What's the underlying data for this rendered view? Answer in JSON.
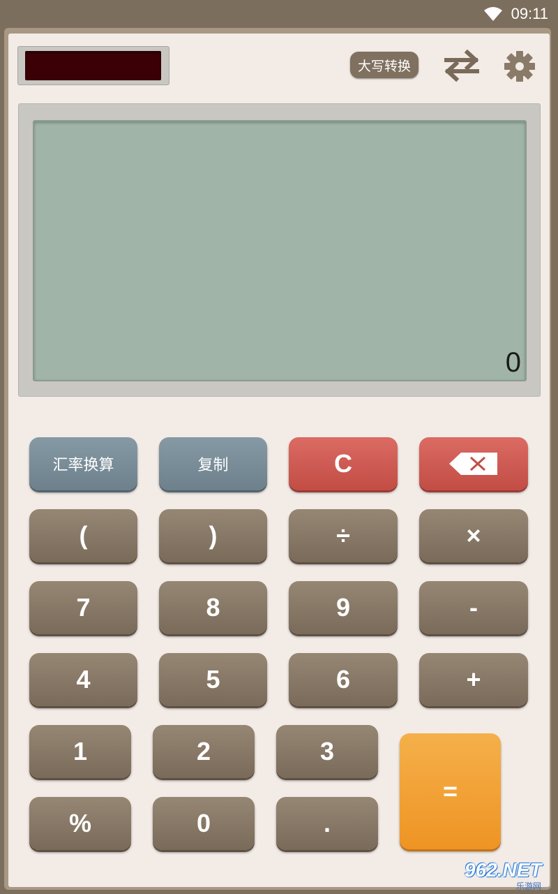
{
  "status_bar": {
    "time": "09:11",
    "wifi_icon": "wifi-icon"
  },
  "top_bar": {
    "uppercase_convert_label": "大写转换",
    "swap_icon": "swap-arrows-icon",
    "settings_icon": "gear-icon"
  },
  "display": {
    "value": "0"
  },
  "keys": {
    "currency": "汇率换算",
    "copy": "复制",
    "clear": "C",
    "backspace_icon": "backspace-icon",
    "lparen": "(",
    "rparen": ")",
    "divide": "÷",
    "multiply": "×",
    "seven": "7",
    "eight": "8",
    "nine": "9",
    "minus": "-",
    "four": "4",
    "five": "5",
    "six": "6",
    "plus": "+",
    "one": "1",
    "two": "2",
    "three": "3",
    "equals": "=",
    "percent": "%",
    "zero": "0",
    "dot": "."
  },
  "watermark": {
    "main": "962.NET",
    "sub": "乐游网"
  },
  "colors": {
    "frame": "#7c6e5d",
    "body": "#f2ebe6",
    "lcd": "#a0b5a8",
    "key_brown": "#8a7a68",
    "key_blue": "#7b8e99",
    "key_red": "#d05b53",
    "key_orange": "#f0a030"
  }
}
